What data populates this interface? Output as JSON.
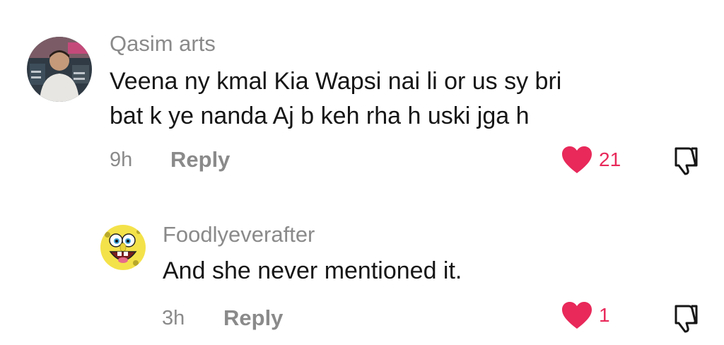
{
  "comments": [
    {
      "username": "Qasim arts",
      "text_line1": "Veena ny kmal Kia Wapsi nai li or us sy bri",
      "text_line2": "bat k ye nanda Aj b keh rha h uski jga h",
      "time": "9h",
      "reply_label": "Reply",
      "like_count": "21",
      "liked": true
    },
    {
      "username": "Foodlyeverafter",
      "text": "And she never mentioned it.",
      "time": "3h",
      "reply_label": "Reply",
      "like_count": "1",
      "liked": true
    }
  ],
  "colors": {
    "like": "#e8295a",
    "meta": "#8a8a8a",
    "text": "#161616"
  },
  "icons": {
    "like": "heart-icon",
    "dislike": "thumbs-down-icon"
  }
}
